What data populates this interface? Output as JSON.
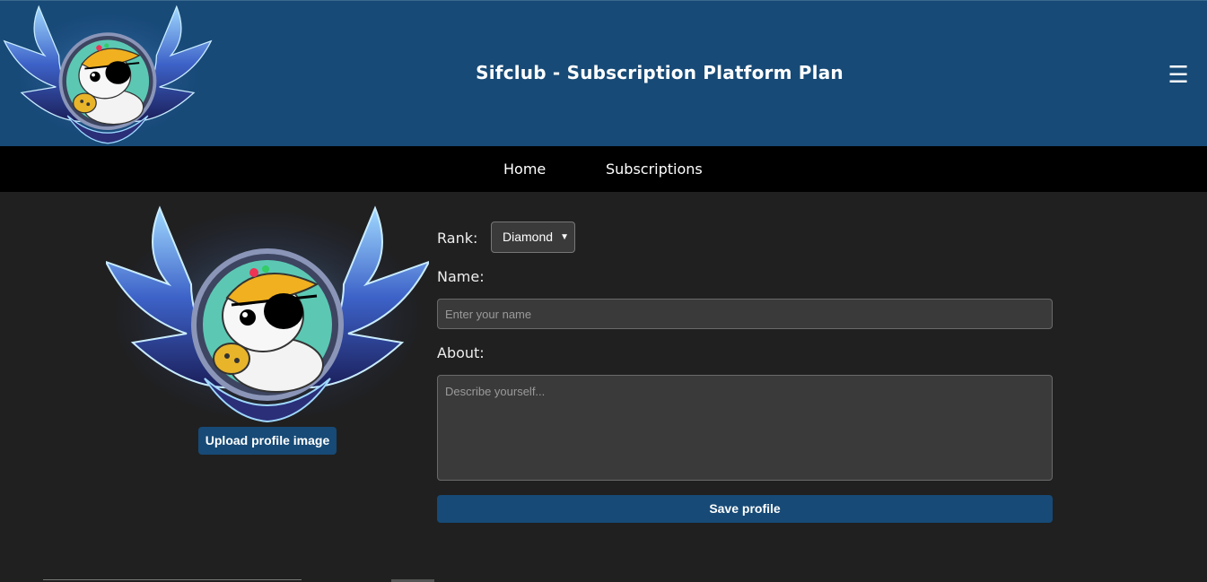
{
  "header": {
    "title": "Sifclub - Subscription Platform Plan",
    "menu_icon": "☰",
    "logo_icon": "hamster-pirate-emblem-icon"
  },
  "nav": {
    "items": [
      {
        "label": "Home"
      },
      {
        "label": "Subscriptions"
      }
    ]
  },
  "profile": {
    "avatar_icon": "hamster-pirate-emblem-icon",
    "upload_label": "Upload profile image"
  },
  "form": {
    "rank_label": "Rank:",
    "rank_value": "Diamond",
    "name_label": "Name:",
    "name_placeholder": "Enter your name",
    "about_label": "About:",
    "about_placeholder": "Describe yourself...",
    "save_label": "Save profile"
  },
  "colors": {
    "header_bg": "#174a76",
    "nav_bg": "#000000",
    "page_bg": "#202020",
    "button_bg": "#174a76"
  }
}
